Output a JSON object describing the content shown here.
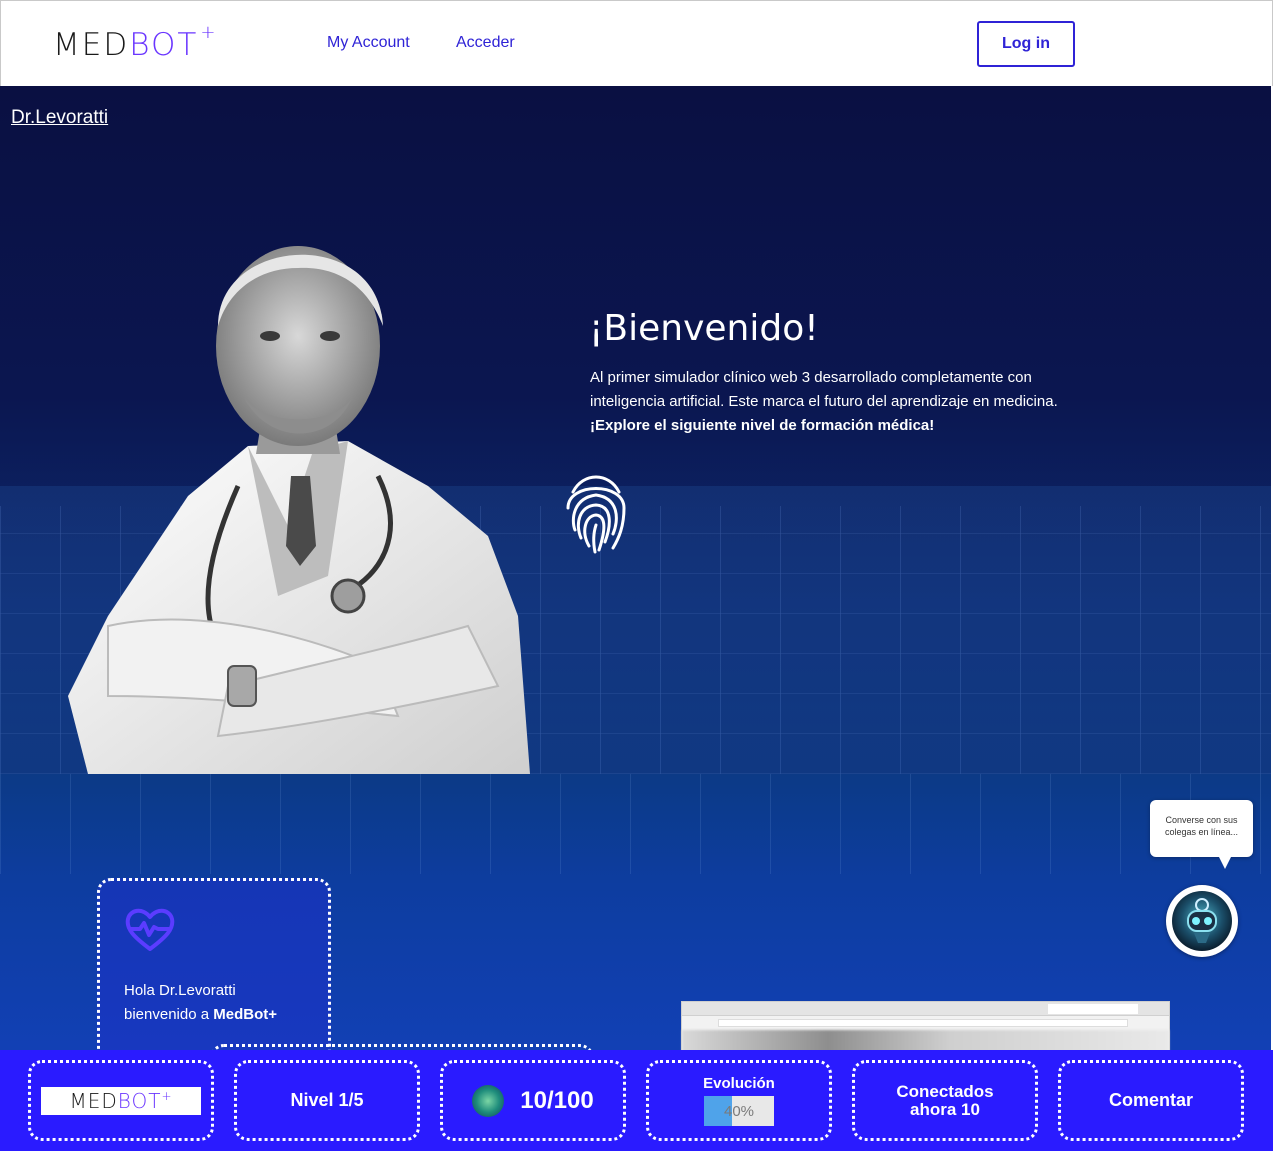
{
  "header": {
    "logo": {
      "part1": "MED",
      "part2": "BOT",
      "sup": "+"
    },
    "nav": [
      "My Account",
      "Acceder"
    ],
    "login_label": "Log in"
  },
  "hero": {
    "user_link": "Dr.Levoratti",
    "title": "¡Bienvenido!",
    "text": "Al primer simulador clínico web 3 desarrollado completamente con inteligencia artificial. Este marca el futuro del aprendizaje en medicina.",
    "text_strong": "¡Explore el siguiente nivel de formación médica!"
  },
  "welcome_card": {
    "line1": "Hola Dr.Levoratti",
    "line2_prefix": "bienvenido a ",
    "line2_brand": "MedBot+"
  },
  "chat": {
    "bubble_text": "Converse con sus colegas en línea..."
  },
  "bottom_bar": {
    "logo": {
      "part1": "MED",
      "part2": "BOT",
      "sup": "+"
    },
    "level": "Nivel 1/5",
    "score": "10/100",
    "evolution_label": "Evolución",
    "evolution_percent": "40%",
    "evolution_value": 0.4,
    "connected": "Conectados ahora 10",
    "comment": "Comentar"
  },
  "colors": {
    "brand_primary": "#2a1bff",
    "brand_accent": "#6a35ff",
    "hero_dark": "#0a1042",
    "link_blue": "#2f23d6"
  }
}
